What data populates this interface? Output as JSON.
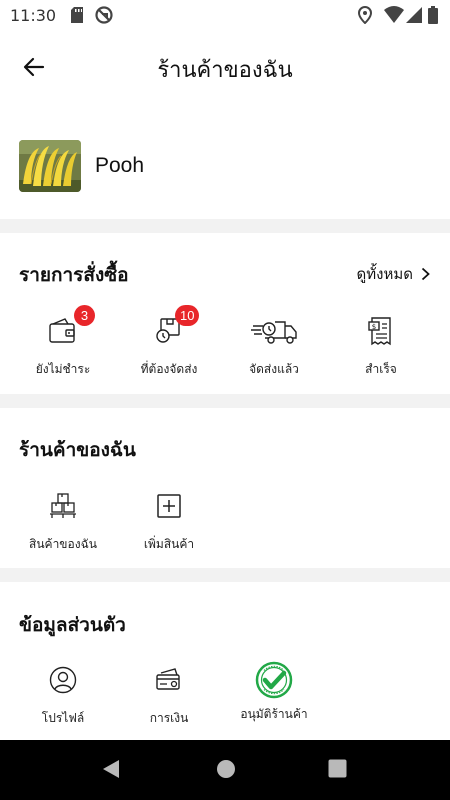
{
  "status_bar": {
    "time": "11:30",
    "left_icons": [
      "sd-card-icon",
      "do-not-disturb-icon"
    ],
    "right_icons": [
      "location-icon",
      "wifi-icon",
      "signal-icon",
      "battery-icon"
    ]
  },
  "header": {
    "title": "ร้านค้าของฉัน",
    "back_icon": "arrow-left-icon"
  },
  "profile": {
    "name": "Pooh",
    "avatar_icon": "banana-photo"
  },
  "orders": {
    "title": "รายการสั่งซื้อ",
    "see_all": "ดูทั้งหมด",
    "items": [
      {
        "label": "ยังไม่ชำระ",
        "badge": "3",
        "icon": "wallet-icon"
      },
      {
        "label": "ที่ต้องจัดส่ง",
        "badge": "10",
        "icon": "package-icon"
      },
      {
        "label": "จัดส่งแล้ว",
        "icon": "delivery-truck-icon"
      },
      {
        "label": "สำเร็จ",
        "icon": "receipt-icon"
      }
    ]
  },
  "my_shop": {
    "title": "ร้านค้าของฉัน",
    "items": [
      {
        "label": "สินค้าของฉัน",
        "icon": "boxes-icon"
      },
      {
        "label": "เพิ่มสินค้า",
        "icon": "add-box-icon"
      }
    ]
  },
  "personal": {
    "title": "ข้อมูลส่วนตัว",
    "items": [
      {
        "label": "โปรไฟล์",
        "icon": "user-circle-icon"
      },
      {
        "label": "การเงิน",
        "icon": "credit-card-icon"
      },
      {
        "label": "อนุมัติร้านค้า",
        "icon": "verified-badge-icon"
      }
    ]
  },
  "colors": {
    "badge": "#e8262a",
    "verified_green": "#22a847",
    "divider": "#f2f2f2",
    "nav_bar": "#000000"
  },
  "nav_bar": {
    "buttons": [
      "back-triangle-icon",
      "home-circle-icon",
      "recents-square-icon"
    ]
  }
}
